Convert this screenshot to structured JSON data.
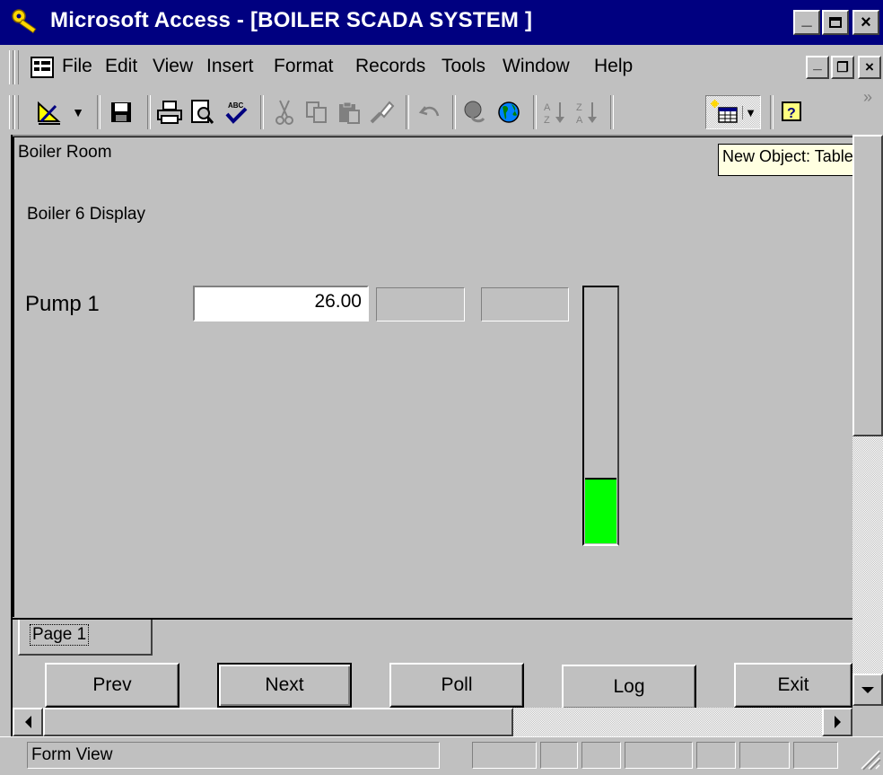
{
  "window": {
    "title": "Microsoft Access - [BOILER SCADA SYSTEM ]",
    "minimize_glyph": "_",
    "restore_glyph": "□",
    "close_glyph": "×"
  },
  "menu": {
    "items": [
      "File",
      "Edit",
      "View",
      "Insert",
      "Format",
      "Records",
      "Tools",
      "Window",
      "Help"
    ],
    "mdi_minimize": "_",
    "mdi_restore": "❐",
    "mdi_close": "×"
  },
  "toolbar": {
    "icons": [
      "design-view-icon",
      "save-icon",
      "print-icon",
      "print-preview-icon",
      "spelling-icon",
      "cut-icon",
      "copy-icon",
      "paste-icon",
      "format-painter-icon",
      "undo-icon",
      "insert-hyperlink-icon",
      "web-toolbar-icon",
      "sort-ascending-icon",
      "sort-descending-icon",
      "new-object-icon",
      "help-icon"
    ],
    "overflow": "»"
  },
  "tooltip": "New Object: Table",
  "form": {
    "header": "Boiler Room",
    "subtitle": "Boiler 6 Display",
    "pump_label": "Pump 1",
    "pump_value": "26.00",
    "level_fraction": 0.25,
    "level_color": "#00ff00"
  },
  "tabs": {
    "page1": "Page 1"
  },
  "buttons": {
    "prev": "Prev",
    "next": "Next",
    "poll": "Poll",
    "log": "Log",
    "exit": "Exit"
  },
  "status": {
    "text": "Form View"
  },
  "colors": {
    "titlebar": "#000080",
    "face": "#c0c0c0",
    "tooltip_bg": "#ffffe1"
  }
}
